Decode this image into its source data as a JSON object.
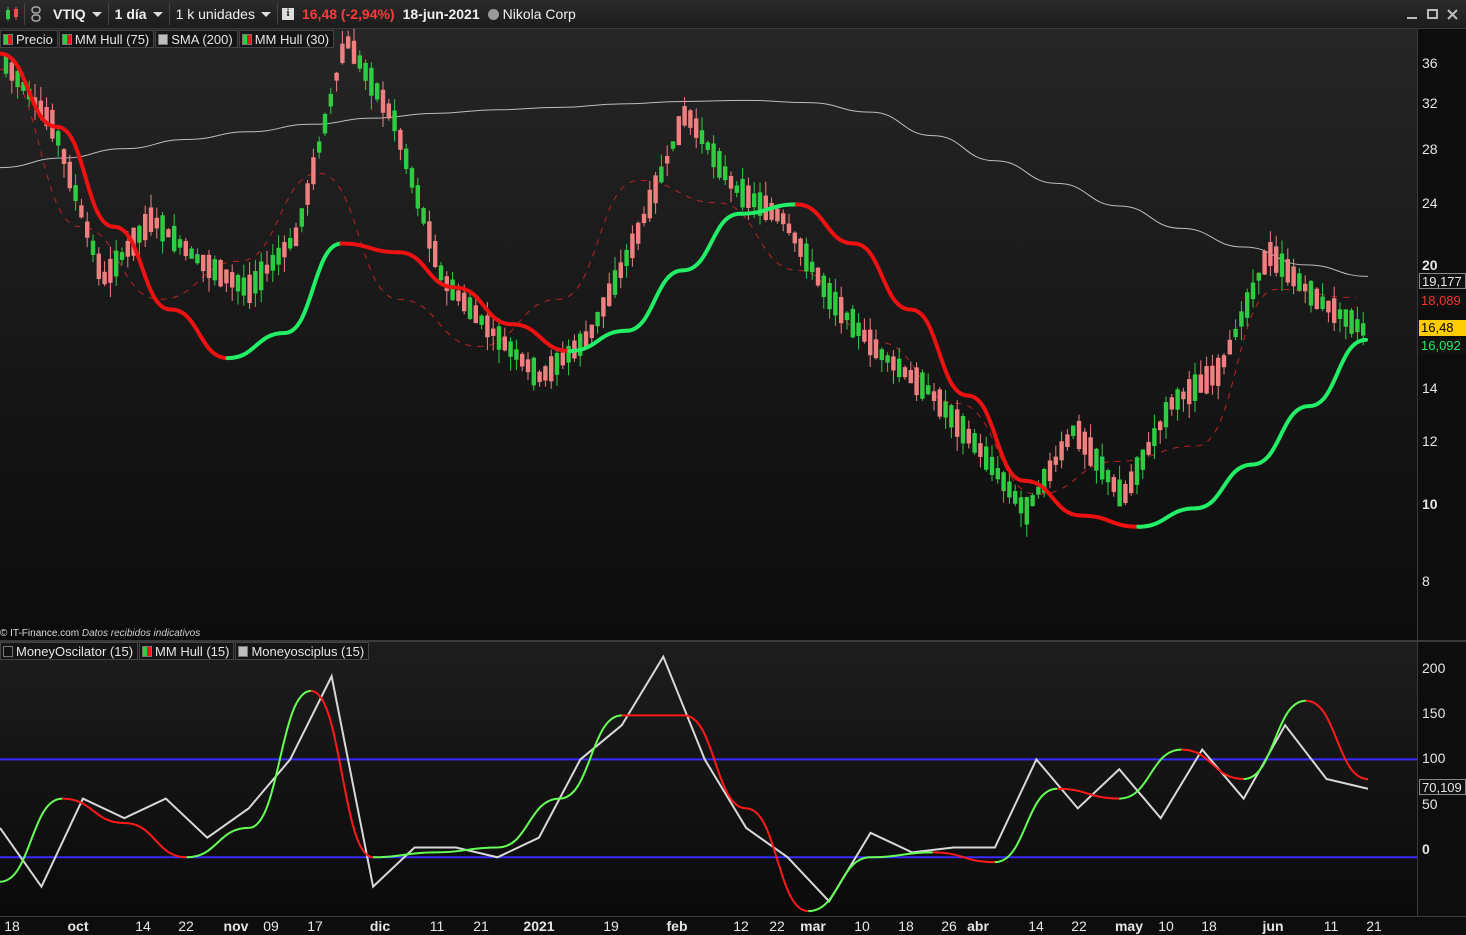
{
  "toolbar": {
    "symbol": "VTIQ",
    "interval": "1 día",
    "volume_unit": "1 k unidades",
    "last_change": "16,48 (-2,94%)",
    "date": "18-jun-2021",
    "company": "Nikola Corp",
    "win_controls": [
      "minimize-icon",
      "maximize-icon",
      "close-icon"
    ]
  },
  "main_legend": [
    {
      "label": "Precio",
      "swatch": "green-red"
    },
    {
      "label": "MM Hull (75)",
      "swatch": "green-red"
    },
    {
      "label": "SMA (200)",
      "swatch": "gray"
    },
    {
      "label": "MM Hull (30)",
      "swatch": "green-red"
    }
  ],
  "osc_legend": [
    {
      "label": "MoneyOscilator (15)",
      "swatch": "dark"
    },
    {
      "label": "MM Hull (15)",
      "swatch": "green-red"
    },
    {
      "label": "Moneyosciplus (15)",
      "swatch": "gray"
    }
  ],
  "credit": {
    "source": "© IT-Finance.com",
    "note": "Datos recibidos indicativos"
  },
  "price_axis": {
    "ticks": [
      "36",
      "32",
      "28",
      "24",
      "20",
      "14",
      "12",
      "10",
      "8"
    ],
    "bold_ticks": [
      "20",
      "10"
    ],
    "tags": {
      "sma200": "19,177",
      "hull75": "18,089",
      "last": "16,48",
      "hull30": "16,092"
    }
  },
  "osc_axis": {
    "ticks": [
      "200",
      "150",
      "100",
      "50",
      "0"
    ],
    "tag": "70,109"
  },
  "date_axis": {
    "labels": [
      "18",
      "oct",
      "14",
      "22",
      "nov",
      "09",
      "17",
      "dic",
      "11",
      "21",
      "2021",
      "19",
      "feb",
      "12",
      "22",
      "mar",
      "10",
      "18",
      "26",
      "abr",
      "14",
      "22",
      "may",
      "10",
      "18",
      "jun",
      "11",
      "21"
    ],
    "bold_labels": [
      "oct",
      "nov",
      "dic",
      "2021",
      "feb",
      "mar",
      "abr",
      "may",
      "jun"
    ]
  },
  "colors": {
    "bull": "#2ecc40",
    "bear": "#f08080",
    "hull_up": "#22ee66",
    "hull_down": "#ee1111",
    "sma": "#bdbdbd",
    "band": "#3a2bff",
    "last_tag": "#ffcc00"
  },
  "chart_data": [
    {
      "type": "candlestick",
      "title": "VTIQ",
      "scale": "log",
      "ylim": [
        7,
        38
      ],
      "series": [
        {
          "name": "SMA (200)",
          "values": [
            25.9,
            26.6,
            27.3,
            28.0,
            28.6,
            29.2,
            29.7,
            30.1,
            30.4,
            30.6,
            30.9,
            31.1,
            31.2,
            31.0,
            30.2,
            28.3,
            26.4,
            24.8,
            23.3,
            21.9,
            20.8,
            19.8,
            19.18
          ]
        },
        {
          "name": "MM Hull (75)",
          "values": [
            35.5,
            29.0,
            22.0,
            17.5,
            15.3,
            16.4,
            21.0,
            20.5,
            18.6,
            16.8,
            15.6,
            16.5,
            19.5,
            22.8,
            23.4,
            21.0,
            17.5,
            13.8,
            10.9,
            9.9,
            9.6,
            10.1,
            11.4,
            13.4,
            16.09
          ]
        },
        {
          "name": "MM Hull (30)",
          "values": [
            34.0,
            22.0,
            18.0,
            20.0,
            25.5,
            18.0,
            15.8,
            18.0,
            25.0,
            23.5,
            19.5,
            16.0,
            13.5,
            10.5,
            11.5,
            12.0,
            18.5,
            18.09
          ]
        },
        {
          "name": "Precio",
          "values": [
            34.5,
            29.0,
            19.0,
            22.5,
            20.0,
            18.5,
            21.5,
            37.0,
            29.5,
            19.0,
            16.5,
            14.5,
            16.2,
            21.5,
            30.2,
            24.5,
            22.5,
            18.0,
            15.5,
            14.0,
            12.0,
            10.0,
            12.6,
            10.4,
            13.5,
            14.8,
            20.5,
            18.0,
            16.48
          ]
        }
      ]
    },
    {
      "type": "line",
      "ylim": [
        -60,
        220
      ],
      "series": [
        {
          "name": "Moneyosciplus (15)",
          "values": [
            30,
            -30,
            60,
            40,
            60,
            20,
            50,
            100,
            185,
            -30,
            10,
            10,
            0,
            20,
            100,
            135,
            205,
            100,
            30,
            0,
            -45,
            25,
            5,
            10,
            10,
            100,
            50,
            90,
            40,
            110,
            60,
            135,
            80,
            70
          ]
        },
        {
          "name": "MM Hull (15)",
          "values": [
            -25,
            60,
            35,
            0,
            30,
            170,
            0,
            5,
            10,
            60,
            145,
            145,
            50,
            -55,
            0,
            5,
            -5,
            70,
            60,
            110,
            80,
            160,
            80
          ]
        }
      ],
      "bands": [
        0,
        100
      ]
    }
  ]
}
